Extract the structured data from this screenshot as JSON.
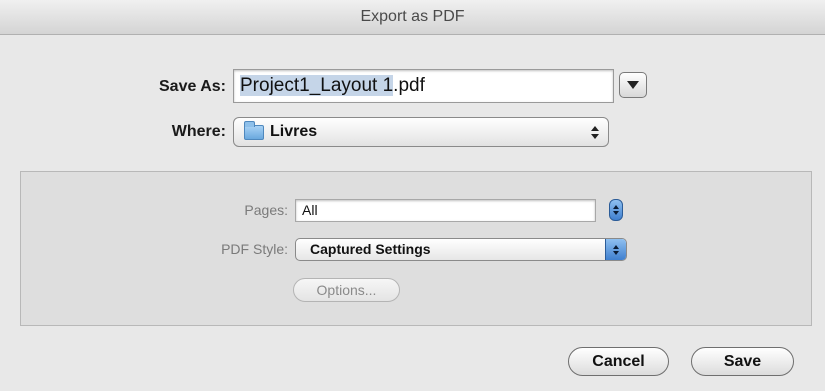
{
  "window": {
    "title": "Export as PDF"
  },
  "save_as": {
    "label": "Save As:",
    "filename": "Project1_Layout 1.pdf",
    "selected_part": "Project1_Layout 1"
  },
  "where": {
    "label": "Where:",
    "folder": "Livres",
    "folder_icon": "folder-icon"
  },
  "options": {
    "pages_label": "Pages:",
    "pages_value": "All",
    "pdf_style_label": "PDF Style:",
    "pdf_style_value": "Captured Settings",
    "options_button": "Options..."
  },
  "buttons": {
    "cancel": "Cancel",
    "save": "Save"
  },
  "colors": {
    "accent_blue": "#3f7fcf",
    "selection": "#c5d5e8",
    "dialog_bg": "#e8e8e8"
  }
}
